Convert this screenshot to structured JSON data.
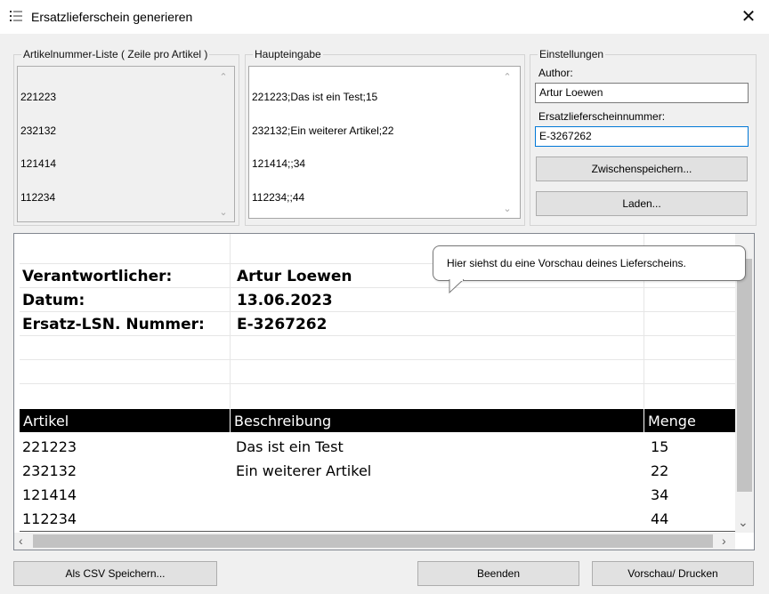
{
  "window": {
    "title": "Ersatzlieferschein generieren",
    "close_symbol": "✕"
  },
  "article_list": {
    "label": "Artikelnummer-Liste ( Zeile pro Artikel )",
    "lines": [
      "221223",
      "232132",
      "121414",
      "112234"
    ]
  },
  "main_input": {
    "label": "Haupteingabe",
    "lines": [
      "221223;Das ist ein Test;15",
      "232132;Ein weiterer Artikel;22",
      "121414;;34",
      "112234;;44"
    ]
  },
  "settings": {
    "label": "Einstellungen",
    "author_label": "Author:",
    "author_value": "Artur Loewen",
    "number_label": "Ersatzlieferscheinnummer:",
    "number_value": "E-3267262",
    "save_temp_label": "Zwischenspeichern...",
    "load_label": "Laden..."
  },
  "preview": {
    "info": [
      {
        "label": "Verantwortlicher:",
        "value": "Artur Loewen"
      },
      {
        "label": "Datum:",
        "value": "13.06.2023"
      },
      {
        "label": "Ersatz-LSN. Nummer:",
        "value": "E-3267262"
      }
    ],
    "columns": [
      "Artikel",
      "Beschreibung",
      "Menge"
    ],
    "rows": [
      [
        "221223",
        "Das ist ein Test",
        "15"
      ],
      [
        "232132",
        "Ein weiterer Artikel",
        "22"
      ],
      [
        "121414",
        "",
        "34"
      ],
      [
        "112234",
        "",
        "44"
      ]
    ],
    "tooltip": "Hier siehst du eine Vorschau deines Lieferscheins."
  },
  "footer": {
    "csv_label": "Als CSV Speichern...",
    "exit_label": "Beenden",
    "print_label": "Vorschau/ Drucken"
  },
  "colors": {
    "focus_border": "#0078d7",
    "header_bg": "#000000"
  }
}
